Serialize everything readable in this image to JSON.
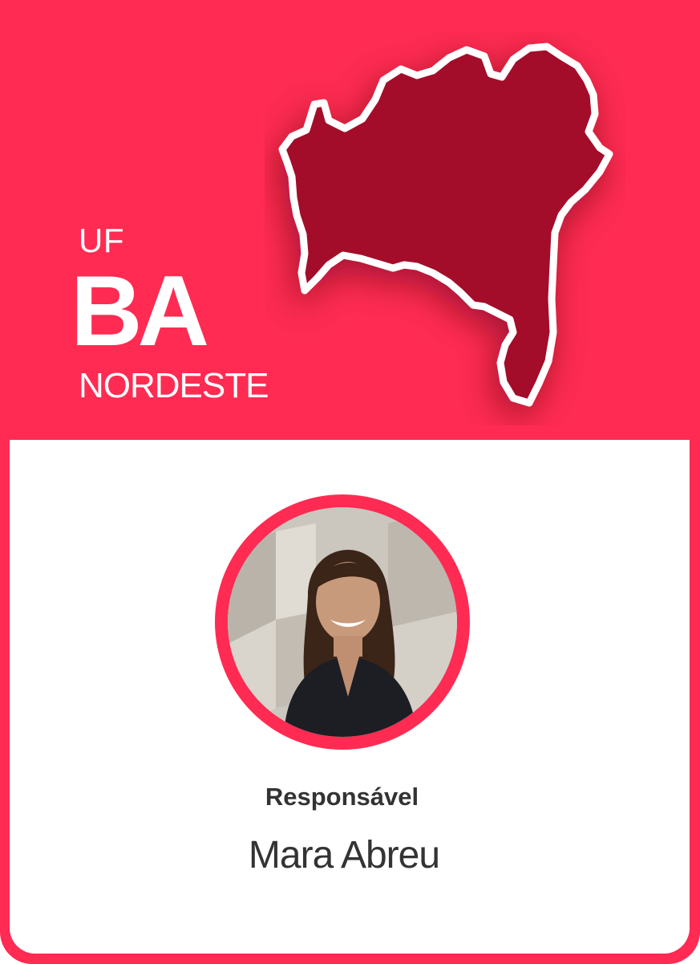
{
  "header": {
    "uf_label": "UF",
    "uf_code": "BA",
    "region": "NORDESTE"
  },
  "map": {
    "icon": "bahia-state-map-icon",
    "fill_color": "#a30e2a",
    "outline_color": "#ffffff"
  },
  "person": {
    "photo": "avatar-photo",
    "role_label": "Responsável",
    "name": "Mara Abreu"
  },
  "colors": {
    "brand": "#ff2b52",
    "panel": "#ffffff",
    "text": "#333333"
  }
}
